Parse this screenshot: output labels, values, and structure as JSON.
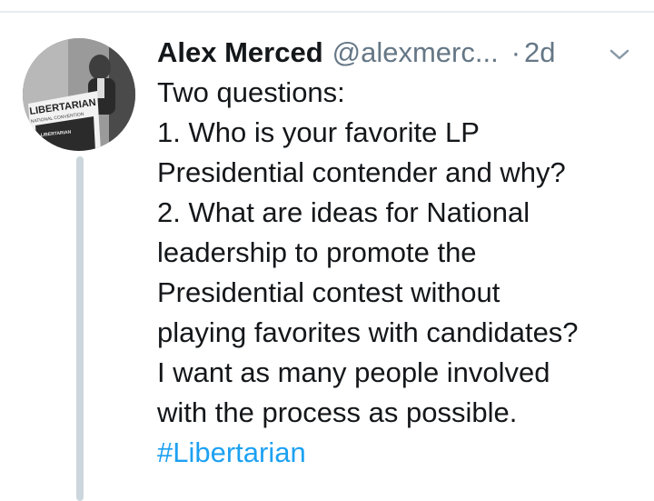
{
  "tweet": {
    "author_name": "Alex Merced",
    "author_handle": "@alexmerc...",
    "separator": "·",
    "time": "2d",
    "menu_icon": "chevron-down-icon",
    "avatar_text": {
      "line1": "LIBERTARIAN",
      "line2": "NATIONAL CONVENTION",
      "podium": "LIBERTARIAN"
    },
    "lines": [
      "Two questions:",
      "1. Who is your favorite LP",
      "Presidential contender and why?",
      "2. What are ideas for National",
      "leadership to promote the",
      "Presidential contest without",
      "playing favorites with candidates?",
      "I want as many people involved",
      "with the process as possible."
    ],
    "hashtag": "#Libertarian"
  },
  "colors": {
    "text": "#14171a",
    "secondary": "#657786",
    "link": "#1da1f2",
    "thread_line": "#ccd6dd",
    "divider": "#e6ecf0"
  }
}
